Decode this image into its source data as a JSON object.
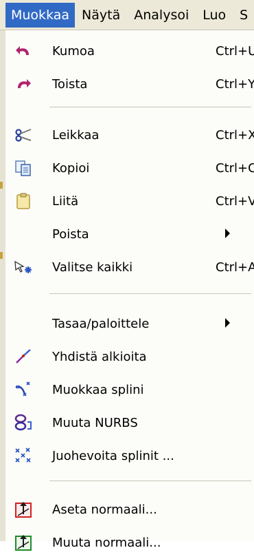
{
  "menubar": {
    "items": [
      {
        "label": "Muokkaa",
        "active": true
      },
      {
        "label": "Näytä"
      },
      {
        "label": "Analysoi"
      },
      {
        "label": "Luo"
      },
      {
        "label": "S"
      }
    ]
  },
  "menu": {
    "items": [
      {
        "label": "Kumoa",
        "shortcut": "Ctrl+U",
        "icon": "undo-icon"
      },
      {
        "label": "Toista",
        "shortcut": "Ctrl+Y",
        "icon": "redo-icon"
      },
      {
        "label": "Leikkaa",
        "shortcut": "Ctrl+X",
        "icon": "scissors-icon"
      },
      {
        "label": "Kopioi",
        "shortcut": "Ctrl+C",
        "icon": "copy-icon"
      },
      {
        "label": "Liitä",
        "shortcut": "Ctrl+V",
        "icon": "paste-icon"
      },
      {
        "label": "Poista",
        "submenu": true
      },
      {
        "label": "Valitse kaikki",
        "shortcut": "Ctrl+A",
        "icon": "select-all-icon"
      },
      {
        "label": "Tasaa/paloittele",
        "submenu": true
      },
      {
        "label": "Yhdistä alkioita",
        "icon": "join-elements-icon"
      },
      {
        "label": "Muokkaa splini",
        "icon": "edit-spline-icon"
      },
      {
        "label": "Muuta NURBS",
        "icon": "nurbs-icon"
      },
      {
        "label": "Juohevoita splinit ...",
        "icon": "smooth-splines-icon"
      },
      {
        "label": "Aseta normaali...",
        "icon": "set-normal-icon"
      },
      {
        "label": "Muuta normaali...",
        "icon": "change-normal-icon"
      }
    ]
  },
  "colors": {
    "menubar_bg": "#ece9d8",
    "highlight": "#316ac5",
    "menu_bg": "#fcfcf9",
    "separator": "#c7c5b8"
  }
}
